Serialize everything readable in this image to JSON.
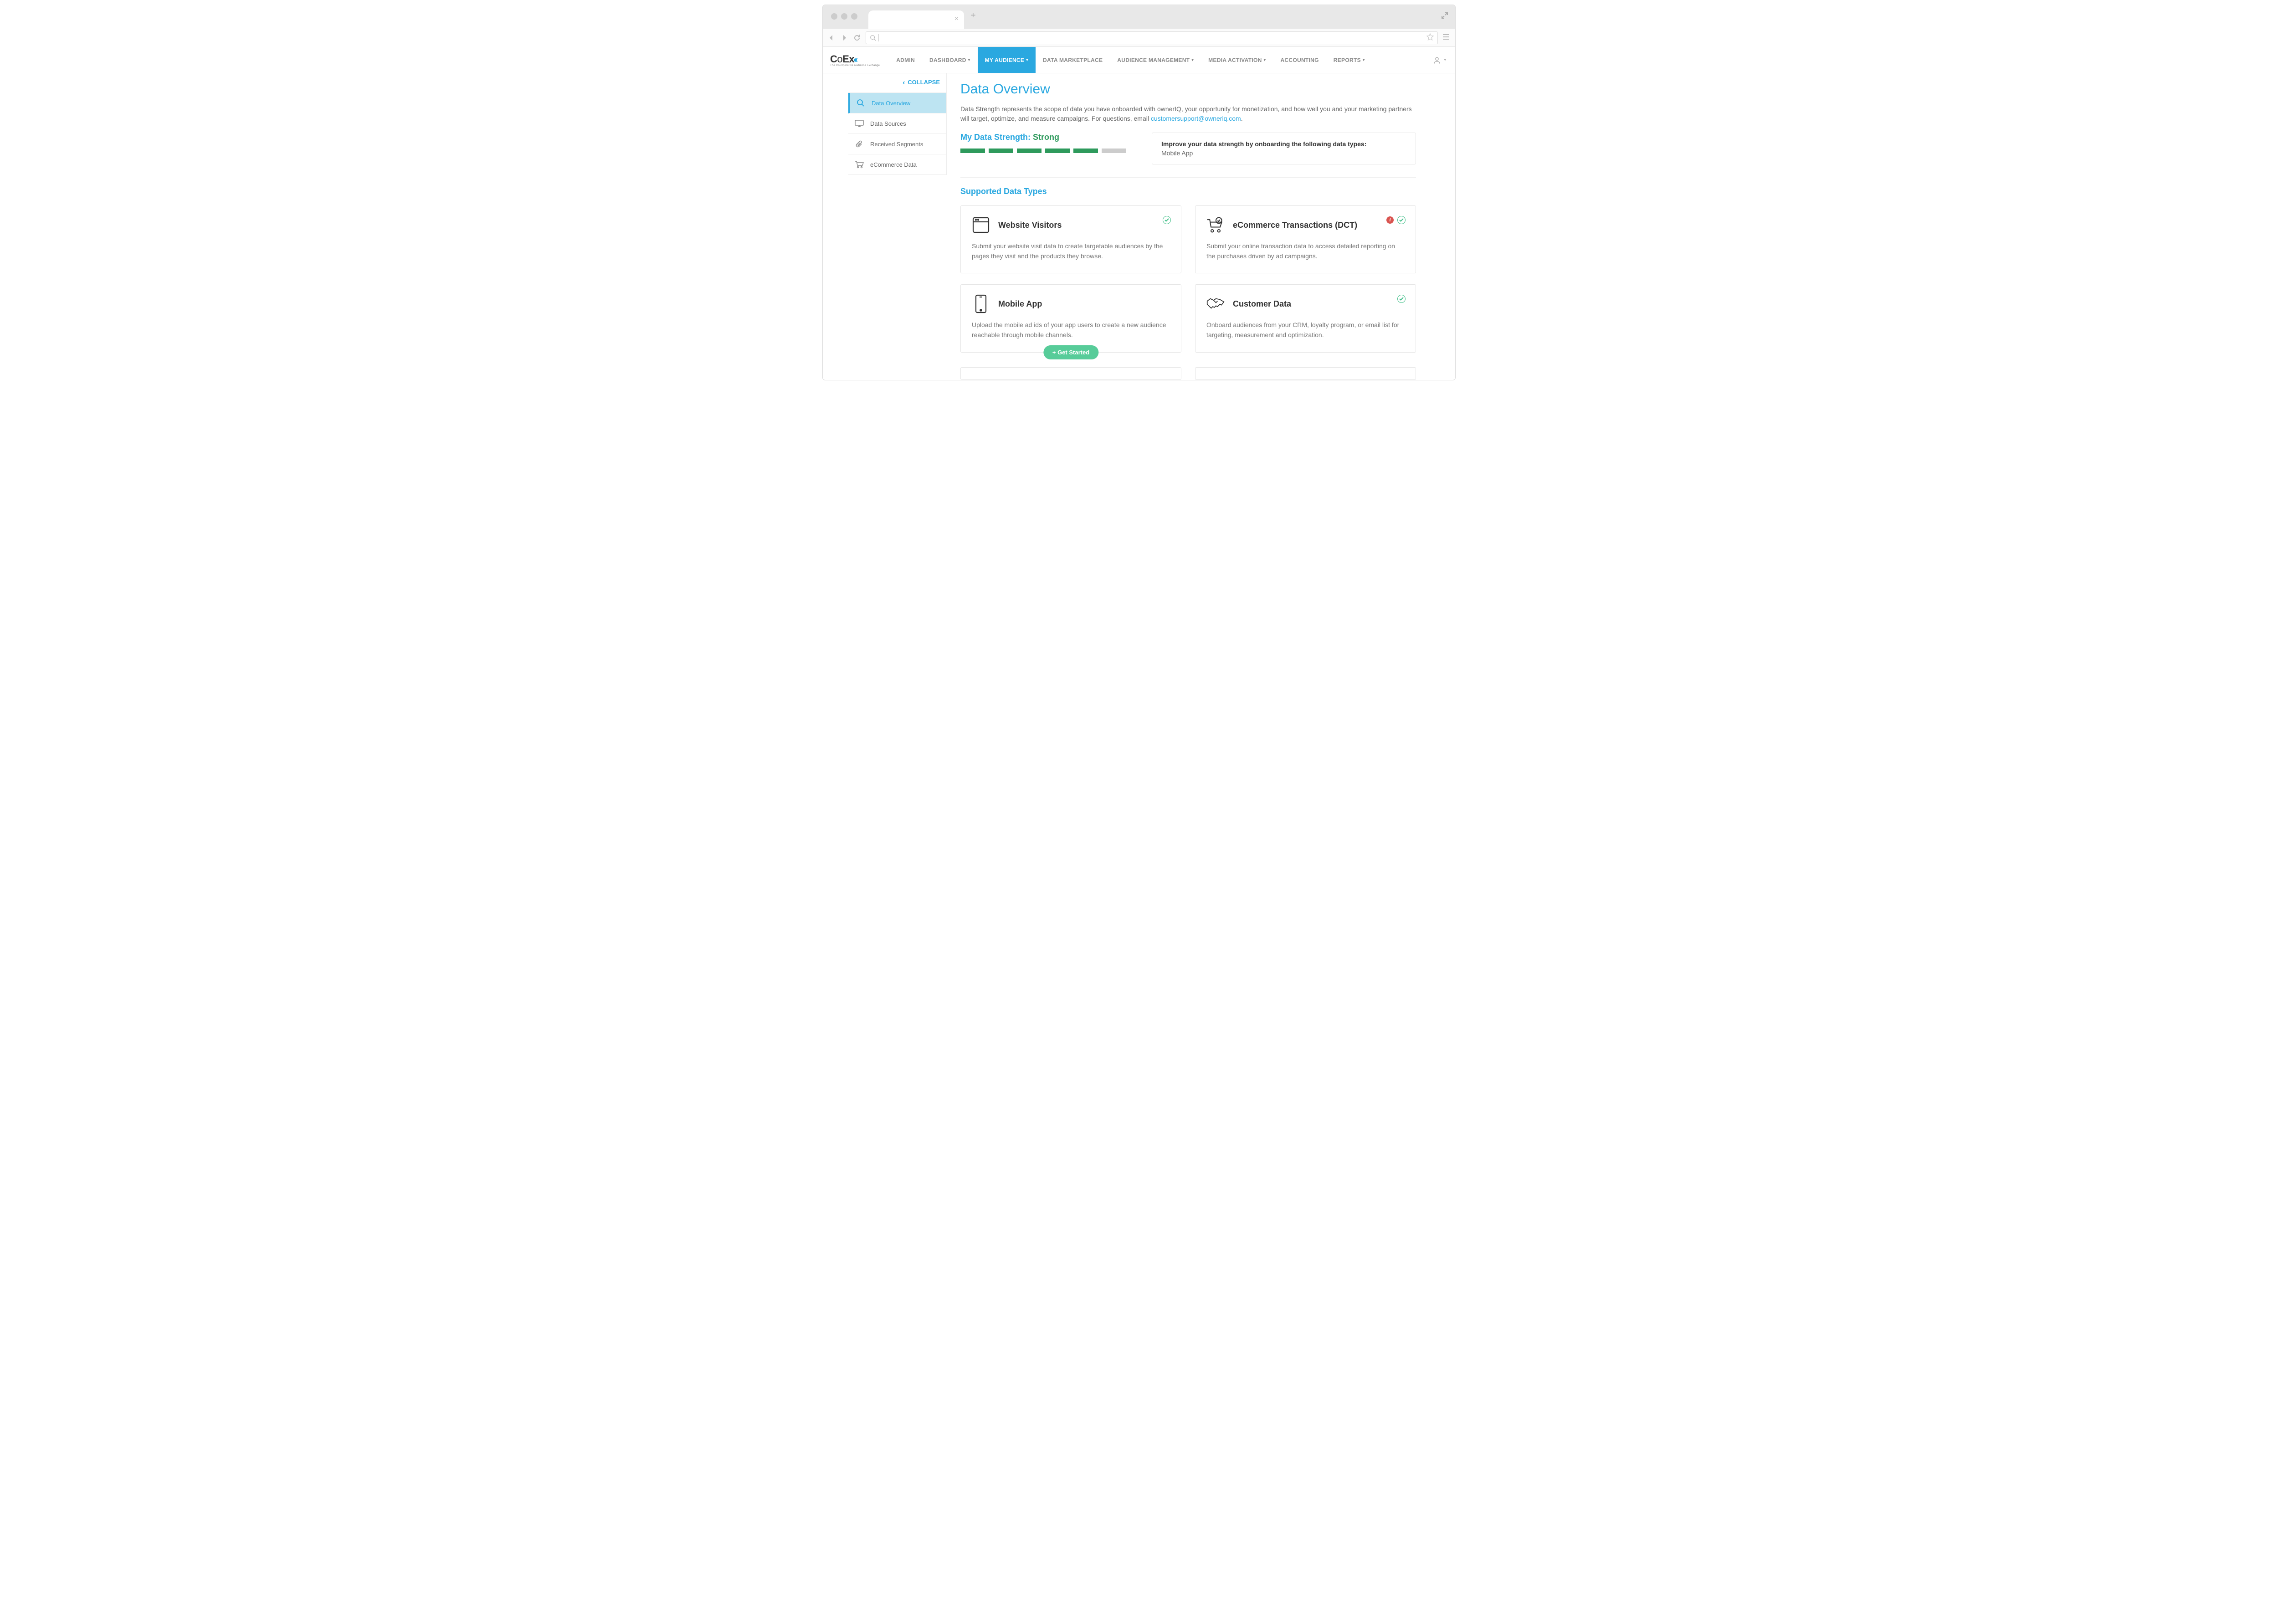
{
  "nav": {
    "items": [
      "ADMIN",
      "DASHBOARD",
      "MY AUDIENCE",
      "DATA MARKETPLACE",
      "AUDIENCE MANAGEMENT",
      "MEDIA ACTIVATION",
      "ACCOUNTING",
      "REPORTS"
    ],
    "has_dropdown": [
      false,
      true,
      true,
      false,
      true,
      true,
      false,
      true
    ],
    "active_index": 2
  },
  "logo": {
    "main": "CoEx",
    "tag": "The Co-Operative Audience Exchange"
  },
  "sidebar": {
    "collapse_label": "COLLAPSE",
    "items": [
      {
        "label": "Data Overview",
        "icon": "search-icon"
      },
      {
        "label": "Data Sources",
        "icon": "monitor-icon"
      },
      {
        "label": "Received Segments",
        "icon": "paperclip-icon"
      },
      {
        "label": "eCommerce Data",
        "icon": "cart-icon"
      }
    ],
    "active_index": 0
  },
  "page": {
    "title": "Data Overview",
    "intro_pre": "Data Strength represents the scope of data you have onboarded with ownerIQ, your opportunity for monetization, and how well you and your marketing partners will target, optimize, and measure campaigns. For questions, email ",
    "intro_link": "customersupport@owneriq.com",
    "intro_post": "."
  },
  "strength": {
    "label": "My Data Strength: ",
    "value": "Strong",
    "filled": 5,
    "total": 6
  },
  "improve": {
    "heading": "Improve your data strength by onboarding the following data types:",
    "items": [
      "Mobile App"
    ]
  },
  "supported_heading": "Supported Data Types",
  "cards": [
    {
      "title": "Website Visitors",
      "desc": "Submit your website visit data to create targetable audiences by the pages they visit and the products they browse.",
      "icon": "window-icon",
      "status": [
        "check"
      ]
    },
    {
      "title": "eCommerce Transactions (DCT)",
      "desc": "Submit your online transaction data to access detailed reporting on the purchases driven by ad campaigns.",
      "icon": "ecommerce-icon",
      "status": [
        "alert",
        "check"
      ]
    },
    {
      "title": "Mobile App",
      "desc": "Upload the mobile ad ids of your app users to create a new audience reachable through mobile channels.",
      "icon": "mobile-icon",
      "status": [],
      "cta": "+ Get Started"
    },
    {
      "title": "Customer Data",
      "desc": "Onboard audiences from your CRM, loyalty program, or email list for targeting, measurement and optimization.",
      "icon": "handshake-icon",
      "status": [
        "check"
      ]
    }
  ]
}
